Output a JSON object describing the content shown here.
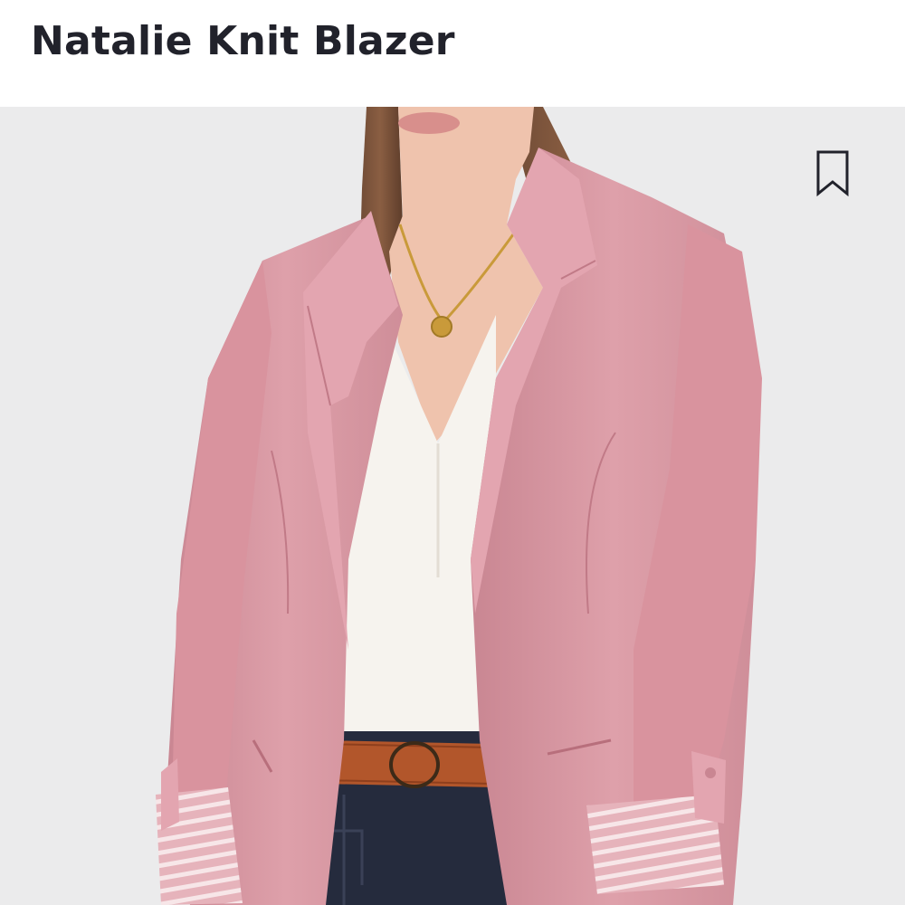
{
  "product": {
    "title": "Natalie Knit Blazer",
    "image": {
      "description_icon": "product-photo",
      "background_color": "#ebebec"
    }
  },
  "actions": {
    "bookmark_icon": "bookmark-icon"
  },
  "colors": {
    "title_text": "#21222b",
    "blazer_pink": "#dc9aa4",
    "shirt_white": "#f6f3ee",
    "belt_brown": "#b2562b",
    "trousers_navy": "#252b3d"
  }
}
